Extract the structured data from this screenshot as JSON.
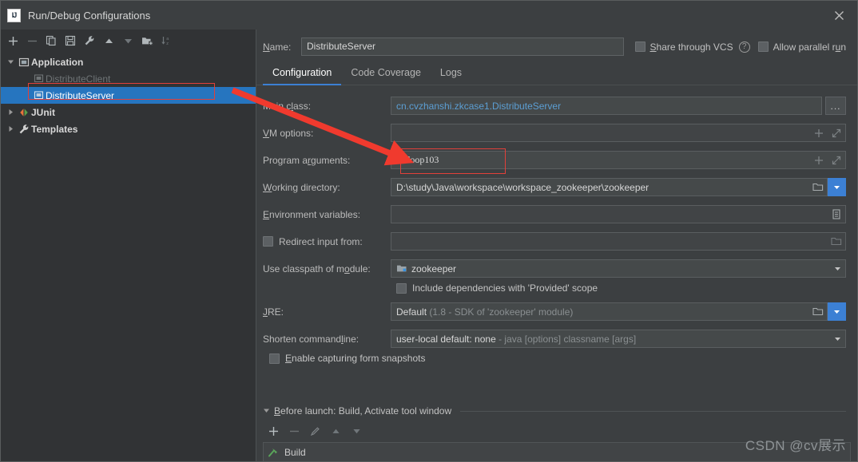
{
  "window": {
    "title": "Run/Debug Configurations",
    "logo_text": "IJ",
    "close_label": "×"
  },
  "sidebar": {
    "toolbar": [
      {
        "name": "add-button",
        "glyph": "+",
        "enabled": true
      },
      {
        "name": "remove-button",
        "glyph": "−",
        "enabled": false
      },
      {
        "name": "copy-button",
        "glyph": "copy-icon",
        "enabled": true
      },
      {
        "name": "save-button",
        "glyph": "save-icon",
        "enabled": true
      },
      {
        "name": "edit-templates-button",
        "glyph": "wrench-icon",
        "enabled": true
      },
      {
        "name": "move-up-button",
        "glyph": "▲",
        "enabled": true
      },
      {
        "name": "move-down-button",
        "glyph": "▼",
        "enabled": false
      },
      {
        "name": "new-folder-button",
        "glyph": "folder-add-icon",
        "enabled": true
      },
      {
        "name": "sort-button",
        "glyph": "sort-az-icon",
        "enabled": false
      }
    ],
    "tree": [
      {
        "label": "Application",
        "icon": "application-icon",
        "level": 0,
        "expanded": true,
        "selected": false,
        "disabled": false
      },
      {
        "label": "DistributeClient",
        "icon": "config-icon",
        "level": 1,
        "expanded": null,
        "selected": false,
        "disabled": true
      },
      {
        "label": "DistributeServer",
        "icon": "config-icon",
        "level": 1,
        "expanded": null,
        "selected": true,
        "disabled": false
      },
      {
        "label": "JUnit",
        "icon": "junit-icon",
        "level": 0,
        "expanded": false,
        "selected": false,
        "disabled": false
      },
      {
        "label": "Templates",
        "icon": "templates-icon",
        "level": 0,
        "expanded": false,
        "selected": false,
        "disabled": false
      }
    ]
  },
  "header": {
    "name_label": "Name:",
    "name_label_mnemonic": "N",
    "name_value": "DistributeServer",
    "share_vcs_label": "Share through VCS",
    "share_vcs_mnemonic": "S",
    "share_vcs_checked": false,
    "help_glyph": "?",
    "allow_parallel_label": "Allow parallel run",
    "allow_parallel_checked": false
  },
  "tabs": [
    {
      "label": "Configuration",
      "active": true
    },
    {
      "label": "Code Coverage",
      "active": false
    },
    {
      "label": "Logs",
      "active": false
    }
  ],
  "form": {
    "main_class": {
      "label_pre": "Main c",
      "label_mnemonic": "l",
      "label_post": "ass:",
      "value": "cn.cvzhanshi.zkcase1.DistributeServer",
      "browse_glyph": "..."
    },
    "vm_options": {
      "label_mnemonic": "V",
      "label_post": "M options:",
      "value": "",
      "add_glyph": "+",
      "expand_glyph": "expand-icon"
    },
    "program_arguments": {
      "label_pre": "Program a",
      "label_mnemonic": "r",
      "label_post": "guments:",
      "value": "hadoop103",
      "add_glyph": "+",
      "expand_glyph": "expand-icon",
      "highlighted": true
    },
    "working_directory": {
      "label_mnemonic": "W",
      "label_post": "orking directory:",
      "value": "D:\\study\\Java\\workspace\\workspace_zookeeper\\zookeeper",
      "folder_glyph": "folder-icon",
      "dropdown_glyph": "▼"
    },
    "environment_variables": {
      "label_mnemonic": "E",
      "label_post": "nvironment variables:",
      "value": "",
      "list_glyph": "list-icon"
    },
    "redirect_input": {
      "label": "Redirect input from:",
      "checked": false,
      "value": "",
      "folder_glyph": "folder-icon"
    },
    "classpath_module": {
      "label_pre": "Use classpath of m",
      "label_mnemonic": "o",
      "label_post": "dule:",
      "value": "zookeeper",
      "module_icon": "module-icon",
      "dropdown_glyph": "▼"
    },
    "include_provided": {
      "label": "Include dependencies with 'Provided' scope",
      "checked": false
    },
    "jre": {
      "label_mnemonic": "J",
      "label_post": "RE:",
      "value_main": "Default",
      "value_muted": " (1.8 - SDK of 'zookeeper' module)",
      "folder_glyph": "folder-icon",
      "dropdown_glyph": "▼"
    },
    "shorten_command_line": {
      "label_pre": "Shorten command ",
      "label_mnemonic": "l",
      "label_post": "ine:",
      "value_main": "user-local default: none",
      "value_muted": " - java [options] classname [args]",
      "dropdown_glyph": "▼"
    },
    "form_snapshots": {
      "label": "Enable capturing form snapshots",
      "label_mnemonic": "E",
      "checked": false
    }
  },
  "before_launch": {
    "title": "Before launch: Build, Activate tool window",
    "title_mnemonic": "B",
    "twisty": "▼",
    "toolbar": [
      {
        "name": "add-task-button",
        "glyph": "+",
        "enabled": true
      },
      {
        "name": "remove-task-button",
        "glyph": "−",
        "enabled": false
      },
      {
        "name": "edit-task-button",
        "glyph": "pencil-icon",
        "enabled": false
      },
      {
        "name": "move-task-up-button",
        "glyph": "▲",
        "enabled": false
      },
      {
        "name": "move-task-down-button",
        "glyph": "▼",
        "enabled": false
      }
    ],
    "items": [
      {
        "label": "Build",
        "icon": "hammer-icon"
      }
    ]
  },
  "watermark": "CSDN @cv展示",
  "colors": {
    "accent_blue": "#3c80d4",
    "selection_blue": "#2675bf",
    "annotation_red": "#e2403a",
    "link_blue": "#5c9fd4",
    "panel_bg": "#3c3f41",
    "sidebar_bg": "#313335",
    "field_bg": "#45494a",
    "hammer_green": "#5aa55a"
  }
}
